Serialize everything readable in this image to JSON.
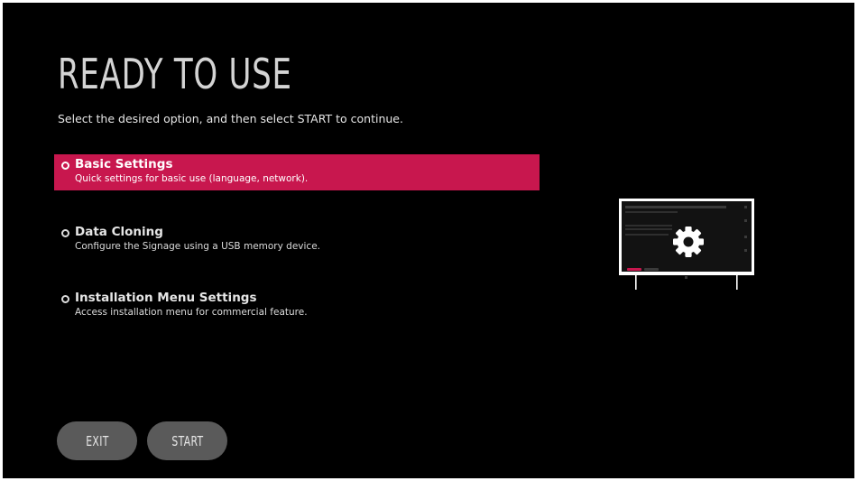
{
  "page": {
    "title": "READY TO USE",
    "subtitle": "Select the desired option, and then select START to continue."
  },
  "options": [
    {
      "name": "Basic Settings",
      "description": "Quick settings for basic use (language, network).",
      "selected": true
    },
    {
      "name": "Data Cloning",
      "description": "Configure the Signage using a USB memory device.",
      "selected": false
    },
    {
      "name": "Installation Menu Settings",
      "description": "Access installation menu for commercial feature.",
      "selected": false
    }
  ],
  "buttons": {
    "exit": "EXIT",
    "start": "START"
  },
  "illustration": {
    "icon": "gear-icon",
    "device": "tv-monitor"
  },
  "colors": {
    "background": "#000000",
    "highlight": "#c8174e",
    "button": "#5a5a5a",
    "text": "#e6e6e6"
  }
}
